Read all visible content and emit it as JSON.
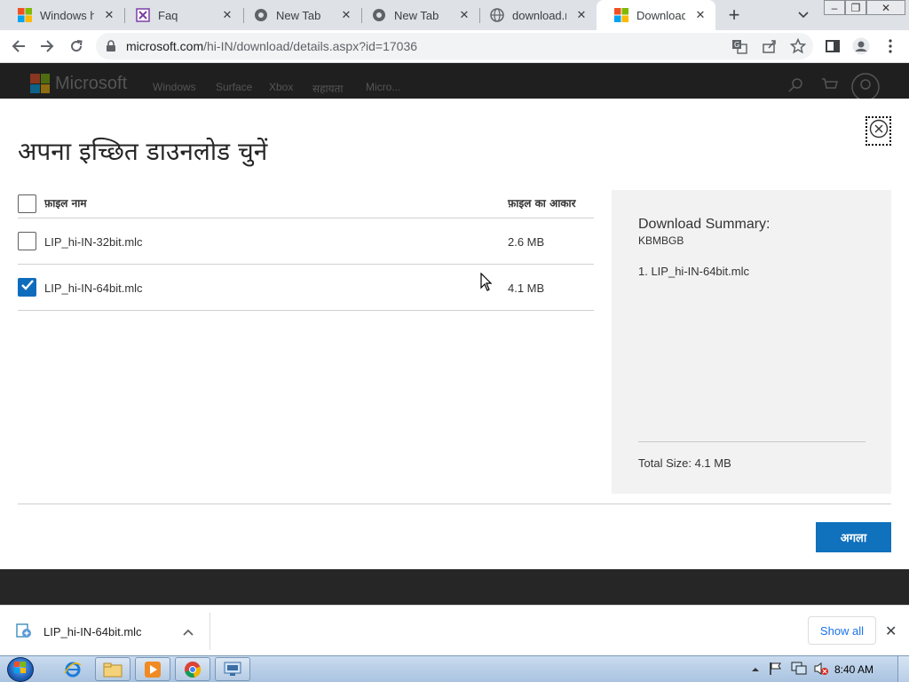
{
  "browser": {
    "tabs": [
      {
        "title": "Windows hel",
        "icon": "microsoft-logo-icon"
      },
      {
        "title": "Faq",
        "icon": "faq-site-icon"
      },
      {
        "title": "New Tab",
        "icon": "chrome-icon"
      },
      {
        "title": "New Tab",
        "icon": "chrome-icon"
      },
      {
        "title": "download.m",
        "icon": "globe-icon"
      },
      {
        "title": "Download W",
        "icon": "microsoft-logo-icon",
        "active": true
      }
    ],
    "url_host": "microsoft.com",
    "url_path": "/hi-IN/download/details.aspx?id=17036"
  },
  "site_header": {
    "brand": "Microsoft",
    "nav": [
      "Windows",
      "Surface",
      "Xbox",
      "सहायता",
      "Micro..."
    ]
  },
  "modal": {
    "title": "अपना इच्छित डाउनलोड चुनें",
    "col_filename": "फ़ाइल नाम",
    "col_filesize": "फ़ाइल का आकार",
    "files": [
      {
        "name": "LIP_hi-IN-32bit.mlc",
        "size": "2.6 MB",
        "checked": false
      },
      {
        "name": "LIP_hi-IN-64bit.mlc",
        "size": "4.1 MB",
        "checked": true
      }
    ],
    "summary": {
      "title": "Download Summary:",
      "code": "KBMBGB",
      "items": [
        "1. LIP_hi-IN-64bit.mlc"
      ],
      "total": "Total Size: 4.1 MB"
    },
    "next_label": "अगला"
  },
  "download_shelf": {
    "file": "LIP_hi-IN-64bit.mlc",
    "show_all": "Show all"
  },
  "taskbar": {
    "clock": "8:40 AM",
    "apps": [
      "internet-explorer-icon",
      "file-explorer-icon",
      "media-player-icon",
      "chrome-icon",
      "remote-desktop-icon"
    ]
  },
  "colors": {
    "accent": "#1071bd",
    "checkbox": "#0f6cbd",
    "tabstrip": "#dee1e6",
    "summary_bg": "#f2f2f2"
  }
}
